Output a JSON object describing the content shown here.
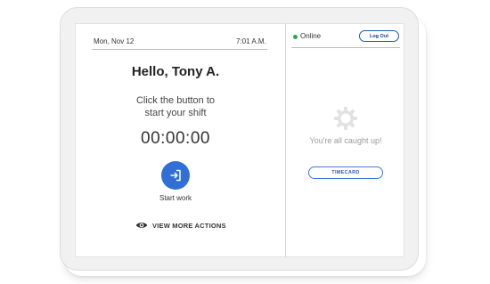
{
  "header": {
    "date": "Mon, Nov 12",
    "time": "7:01 A.M."
  },
  "main": {
    "greeting": "Hello, Tony A.",
    "instruction_line1": "Click the button to",
    "instruction_line2": "start your shift",
    "timer": "00:00:00",
    "start_label": "Start work",
    "more_actions_label": "VIEW MORE ACTIONS"
  },
  "status": {
    "text": "Online",
    "color": "#2aa84a"
  },
  "logout": {
    "label": "Log Out"
  },
  "notifications": {
    "empty_text": "You're all caught up!"
  },
  "timecard": {
    "label": "TIMECARD"
  },
  "icons": {
    "start": "login-arrow-icon",
    "more_actions": "eye-icon",
    "empty_state": "gear-icon"
  },
  "colors": {
    "accent": "#2f6fd6",
    "outline_button": "#3b7be0"
  }
}
